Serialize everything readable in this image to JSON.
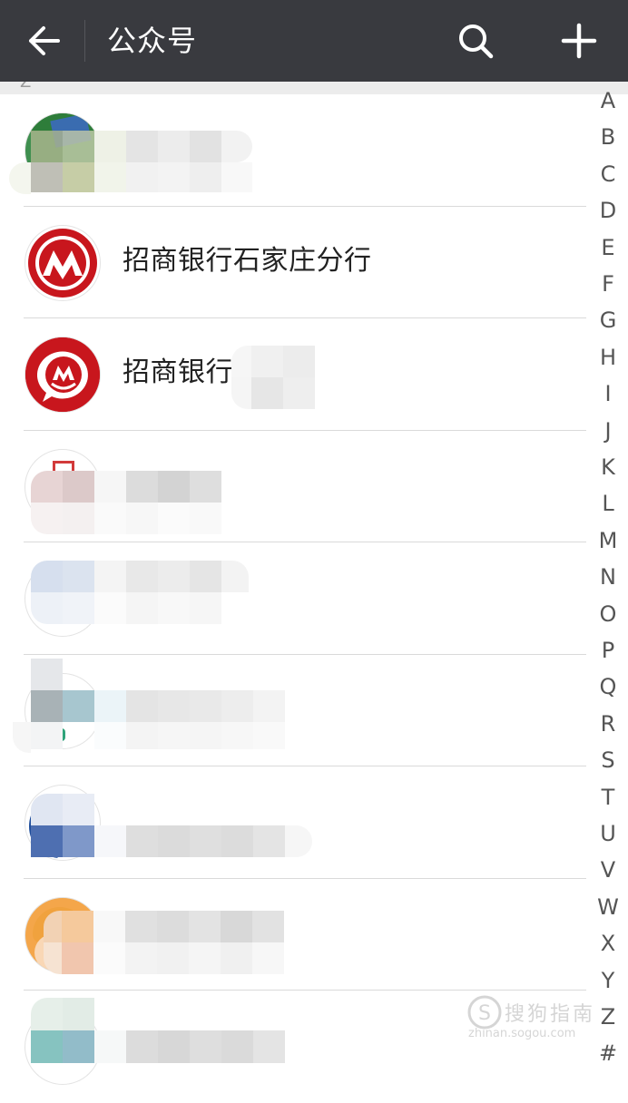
{
  "header": {
    "title": "公众号",
    "back_icon": "arrow-left-icon",
    "search_icon": "search-icon",
    "add_icon": "plus-icon",
    "bg_color": "#393a3f"
  },
  "section": {
    "letter": "Z"
  },
  "accounts": [
    {
      "name": "",
      "avatar": "blurred-avatar"
    },
    {
      "name": "招商银行石家庄分行",
      "avatar": "cmb-logo-ring"
    },
    {
      "name": "招商银行",
      "avatar": "cmb-logo-speech"
    },
    {
      "name": "",
      "avatar": "blurred-avatar"
    },
    {
      "name": "",
      "avatar": "blurred-avatar"
    },
    {
      "name": "",
      "avatar": "blurred-avatar"
    },
    {
      "name": "",
      "avatar": "blurred-avatar"
    },
    {
      "name": "",
      "avatar": "blurred-avatar"
    },
    {
      "name": "",
      "avatar": "blurred-avatar"
    }
  ],
  "index_letters": [
    "A",
    "B",
    "C",
    "D",
    "E",
    "F",
    "G",
    "H",
    "I",
    "J",
    "K",
    "L",
    "M",
    "N",
    "O",
    "P",
    "Q",
    "R",
    "S",
    "T",
    "U",
    "V",
    "W",
    "X",
    "Y",
    "Z",
    "#"
  ],
  "watermark": {
    "text": "搜狗指南",
    "url": "zhinan.sogou.com"
  },
  "colors": {
    "cmb_red": "#c8161d",
    "separator": "#dadada"
  }
}
